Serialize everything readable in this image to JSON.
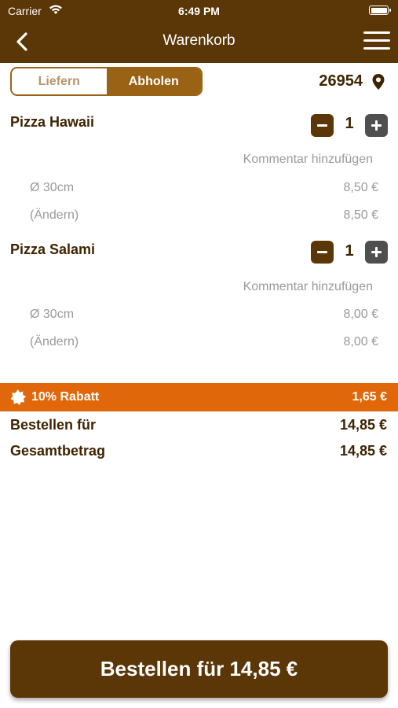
{
  "status_bar": {
    "carrier": "Carrier",
    "time": "6:49 PM"
  },
  "nav": {
    "title": "Warenkorb",
    "back_icon": "chevron-left-icon",
    "menu_icon": "hamburger-menu-icon"
  },
  "mode": {
    "options": [
      "Liefern",
      "Abholen"
    ],
    "selected": "Abholen"
  },
  "location": {
    "zip": "26954",
    "icon": "location-pin-icon"
  },
  "cart": {
    "items": [
      {
        "name": "Pizza Hawaii",
        "quantity": "1",
        "comment_link": "Kommentar hinzufügen",
        "details": [
          {
            "label": "Ø 30cm",
            "price": "8,50 €"
          },
          {
            "label": "(Ändern)",
            "price": "8,50 €"
          }
        ]
      },
      {
        "name": "Pizza Salami",
        "quantity": "1",
        "comment_link": "Kommentar hinzufügen",
        "details": [
          {
            "label": "Ø 30cm",
            "price": "8,00 €"
          },
          {
            "label": "(Ändern)",
            "price": "8,00 €"
          }
        ]
      }
    ]
  },
  "discount": {
    "label": "10% Rabatt",
    "amount": "1,65 €",
    "icon": "badge-icon",
    "color": "#e0680b"
  },
  "totals": {
    "order_for_label": "Bestellen für",
    "order_for_value": "14,85 €",
    "total_label": "Gesamtbetrag",
    "total_value": "14,85 €"
  },
  "order_button": {
    "label": "Bestellen für 14,85 €"
  },
  "colors": {
    "brand": "#5b3606",
    "accent": "#9a6214",
    "text": "#3f2402",
    "muted": "#9a9a9a"
  }
}
